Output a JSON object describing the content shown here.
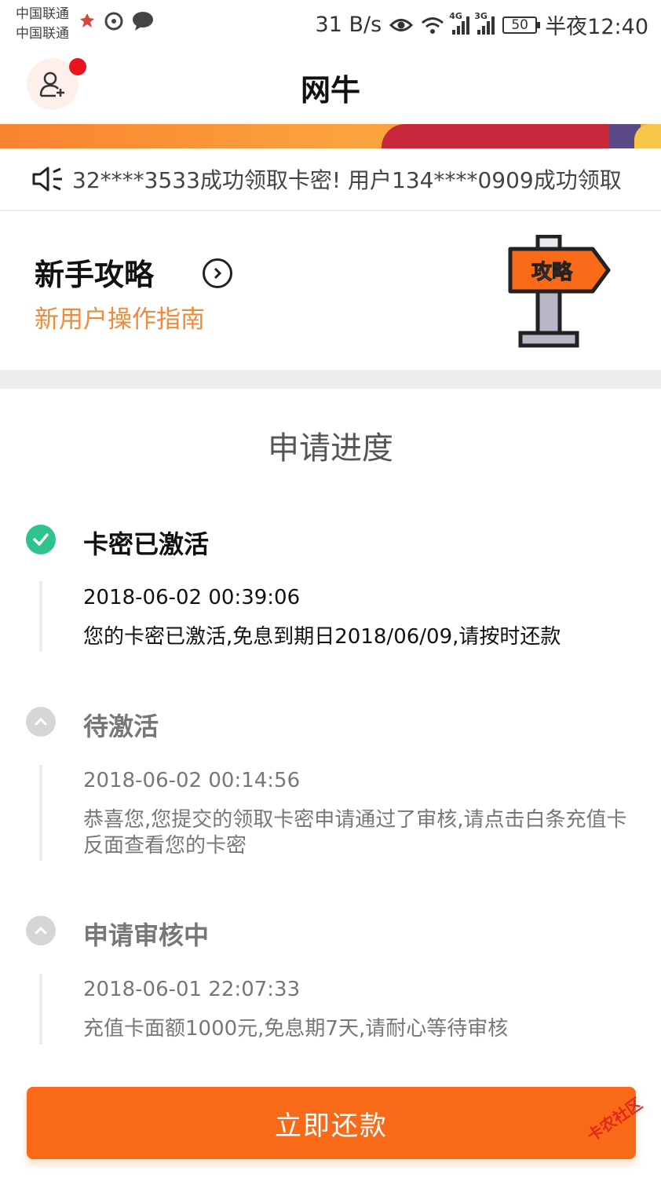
{
  "status_bar": {
    "carrier1": "中国联通",
    "carrier2": "中国联通",
    "speed": "31 B/s",
    "signal1_label": "4G",
    "signal2_label": "3G",
    "battery": "50",
    "time": "半夜12:40"
  },
  "header": {
    "title": "网牛",
    "accent": "#f96a18",
    "notification_dot_color": "#e8141f"
  },
  "notice": {
    "text": "32****3533成功领取卡密!  用户134****0909成功领取"
  },
  "guide": {
    "title": "新手攻略",
    "subtitle": "新用户操作指南",
    "sign_text": "攻略"
  },
  "progress": {
    "title": "申请进度",
    "steps": [
      {
        "title": "卡密已激活",
        "status": "done",
        "time": "2018-06-02 00:39:06",
        "desc": "您的卡密已激活,免息到期日2018/06/09,请按时还款"
      },
      {
        "title": "待激活",
        "status": "pending",
        "time": "2018-06-02 00:14:56",
        "desc": "恭喜您,您提交的领取卡密申请通过了审核,请点击白条充值卡反面查看您的卡密"
      },
      {
        "title": "申请审核中",
        "status": "pending",
        "time": "2018-06-01 22:07:33",
        "desc": "充值卡面额1000元,免息期7天,请耐心等待审核"
      }
    ]
  },
  "action": {
    "pay_label": "立即还款"
  },
  "watermark": "卡农社区"
}
